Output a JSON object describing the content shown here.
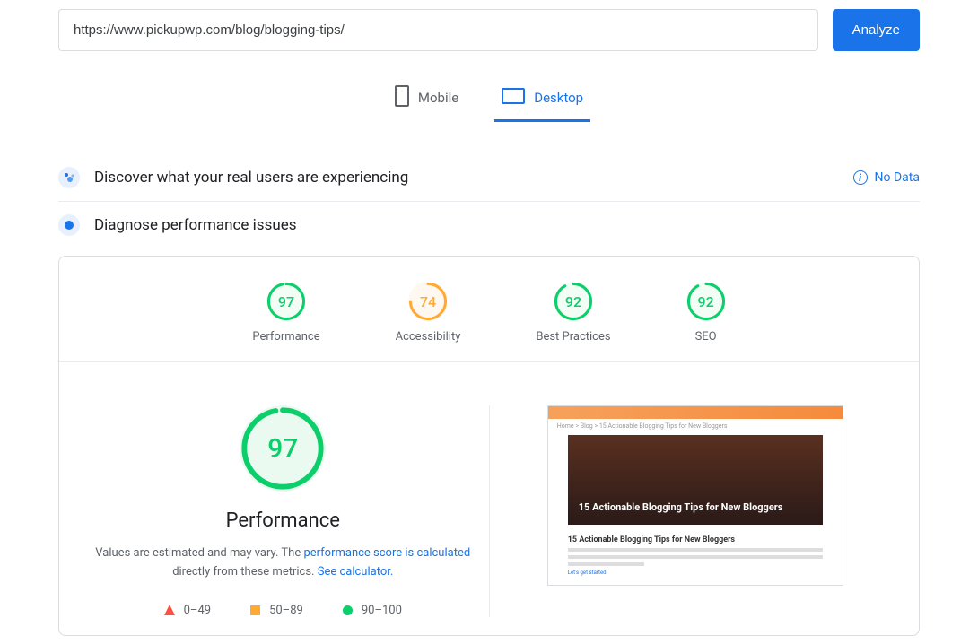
{
  "search": {
    "url": "https://www.pickupwp.com/blog/blogging-tips/",
    "analyze_label": "Analyze"
  },
  "tabs": {
    "mobile": "Mobile",
    "desktop": "Desktop",
    "active": "desktop"
  },
  "sections": {
    "discover_title": "Discover what your real users are experiencing",
    "no_data": "No Data",
    "diagnose_title": "Diagnose performance issues"
  },
  "scores": [
    {
      "value": 97,
      "label": "Performance",
      "color": "green",
      "pct": 97
    },
    {
      "value": 74,
      "label": "Accessibility",
      "color": "orange",
      "pct": 74
    },
    {
      "value": 92,
      "label": "Best Practices",
      "color": "green",
      "pct": 92
    },
    {
      "value": 92,
      "label": "SEO",
      "color": "green",
      "pct": 92
    }
  ],
  "performance_detail": {
    "score": 97,
    "heading": "Performance",
    "desc_prefix": "Values are estimated and may vary. The ",
    "link1": "performance score is calculated",
    "desc_mid": " directly from these metrics. ",
    "link2": "See calculator."
  },
  "legend": {
    "low": "0–49",
    "mid": "50–89",
    "high": "90–100"
  },
  "thumbnail": {
    "breadcrumb": "Home > Blog > 15 Actionable Blogging Tips for New Bloggers",
    "hero_title": "15 Actionable Blogging Tips for New Bloggers",
    "subtitle": "15 Actionable Blogging Tips for New Bloggers",
    "cta": "Let's get started"
  },
  "colors": {
    "green": "#0cce6b",
    "orange": "#ffaa33",
    "red": "#ff4e42",
    "link": "#1a73e8"
  }
}
